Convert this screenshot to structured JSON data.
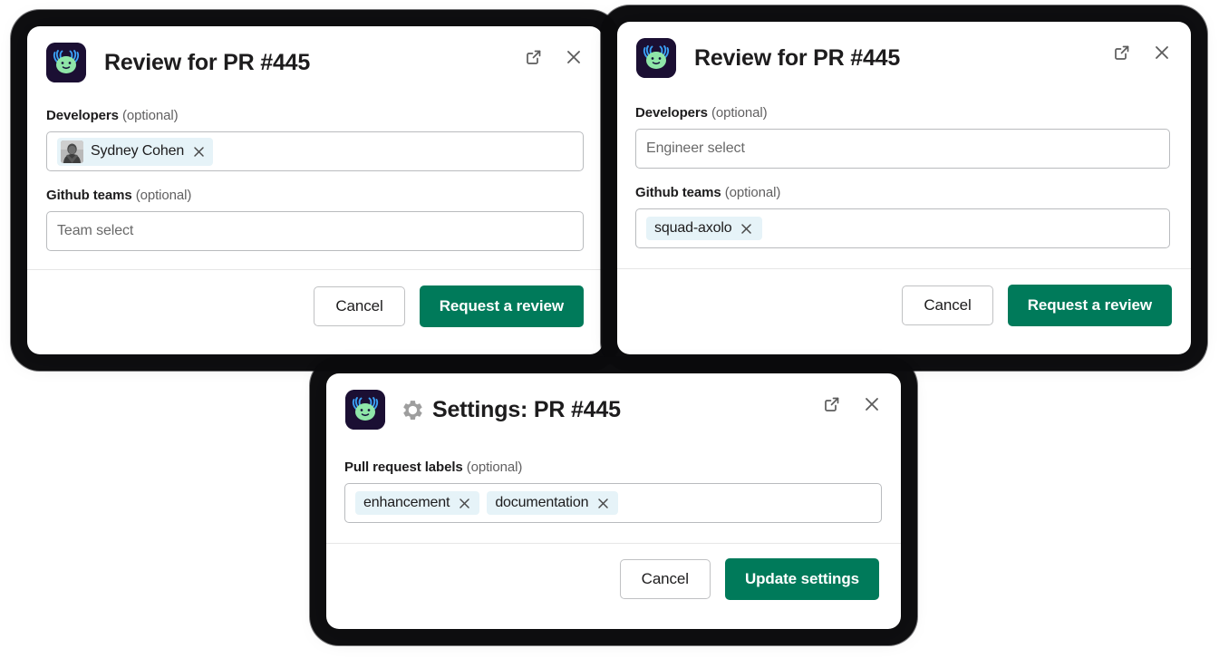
{
  "theme": {
    "primary_green": "#007a5a",
    "chip_background": "#e6f3f8",
    "modal_background": "#ffffff",
    "icon_background": "#1b0f33",
    "axolotl_body": "#8fe6a8",
    "axolotl_gills": "#3aa0f5"
  },
  "modals": [
    {
      "id": "review-pr-445-developer",
      "title": "Review for PR #445",
      "has_gear_icon": false,
      "app_icon_name": "axolotl-app-icon",
      "header_actions": [
        {
          "name": "open-in-new-window-icon",
          "label": "Open in new window"
        },
        {
          "name": "close-icon",
          "label": "Close"
        }
      ],
      "fields": [
        {
          "label": "Developers",
          "optional_suffix": "(optional)",
          "placeholder": "",
          "chips": [
            {
              "label": "Sydney Cohen",
              "has_avatar": true,
              "remove_label": "Remove Sydney Cohen"
            }
          ]
        },
        {
          "label": "Github teams",
          "optional_suffix": "(optional)",
          "placeholder": "Team select",
          "chips": []
        }
      ],
      "footer": {
        "cancel_label": "Cancel",
        "primary_label": "Request a review"
      }
    },
    {
      "id": "review-pr-445-team",
      "title": "Review for PR #445",
      "has_gear_icon": false,
      "app_icon_name": "axolotl-app-icon",
      "header_actions": [
        {
          "name": "open-in-new-window-icon",
          "label": "Open in new window"
        },
        {
          "name": "close-icon",
          "label": "Close"
        }
      ],
      "fields": [
        {
          "label": "Developers",
          "optional_suffix": "(optional)",
          "placeholder": "Engineer select",
          "chips": []
        },
        {
          "label": "Github teams",
          "optional_suffix": "(optional)",
          "placeholder": "",
          "chips": [
            {
              "label": "squad-axolo",
              "has_avatar": false,
              "remove_label": "Remove squad-axolo"
            }
          ]
        }
      ],
      "footer": {
        "cancel_label": "Cancel",
        "primary_label": "Request a review"
      }
    },
    {
      "id": "settings-pr-445",
      "title": "Settings: PR #445",
      "gear_glyph": "⚙",
      "has_gear_icon": true,
      "app_icon_name": "axolotl-app-icon",
      "header_actions": [
        {
          "name": "open-in-new-window-icon",
          "label": "Open in new window"
        },
        {
          "name": "close-icon",
          "label": "Close"
        }
      ],
      "fields": [
        {
          "label": "Pull request labels",
          "optional_suffix": "(optional)",
          "placeholder": "",
          "chips": [
            {
              "label": "enhancement",
              "has_avatar": false,
              "remove_label": "Remove enhancement"
            },
            {
              "label": "documentation",
              "has_avatar": false,
              "remove_label": "Remove documentation"
            }
          ]
        }
      ],
      "footer": {
        "cancel_label": "Cancel",
        "primary_label": "Update settings"
      }
    }
  ]
}
